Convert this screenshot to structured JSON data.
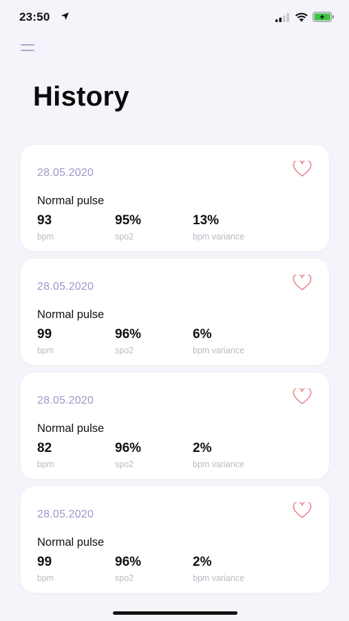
{
  "status_bar": {
    "time": "23:50",
    "icons": [
      "location-arrow-icon",
      "cellular-signal-icon",
      "wifi-icon",
      "battery-charging-icon"
    ],
    "battery_color": "#3ec447"
  },
  "header": {
    "menu_icon": "hamburger-menu-icon",
    "title": "History"
  },
  "colors": {
    "background": "#f4f5fa",
    "card": "#ffffff",
    "date": "#9a97c8",
    "heart": "#e5878c",
    "label": "#b9b9c4"
  },
  "records": [
    {
      "date": "28.05.2020",
      "status": "Normal pulse",
      "metrics": [
        {
          "value": "93",
          "label": "bpm"
        },
        {
          "value": "95%",
          "label": "spo2"
        },
        {
          "value": "13%",
          "label": "bpm variance"
        }
      ]
    },
    {
      "date": "28.05.2020",
      "status": "Normal pulse",
      "metrics": [
        {
          "value": "99",
          "label": "bpm"
        },
        {
          "value": "96%",
          "label": "spo2"
        },
        {
          "value": "6%",
          "label": "bpm variance"
        }
      ]
    },
    {
      "date": "28.05.2020",
      "status": "Normal pulse",
      "metrics": [
        {
          "value": "82",
          "label": "bpm"
        },
        {
          "value": "96%",
          "label": "spo2"
        },
        {
          "value": "2%",
          "label": "bpm variance"
        }
      ]
    },
    {
      "date": "28.05.2020",
      "status": "Normal pulse",
      "metrics": [
        {
          "value": "99",
          "label": "bpm"
        },
        {
          "value": "96%",
          "label": "spo2"
        },
        {
          "value": "2%",
          "label": "bpm variance"
        }
      ]
    }
  ]
}
